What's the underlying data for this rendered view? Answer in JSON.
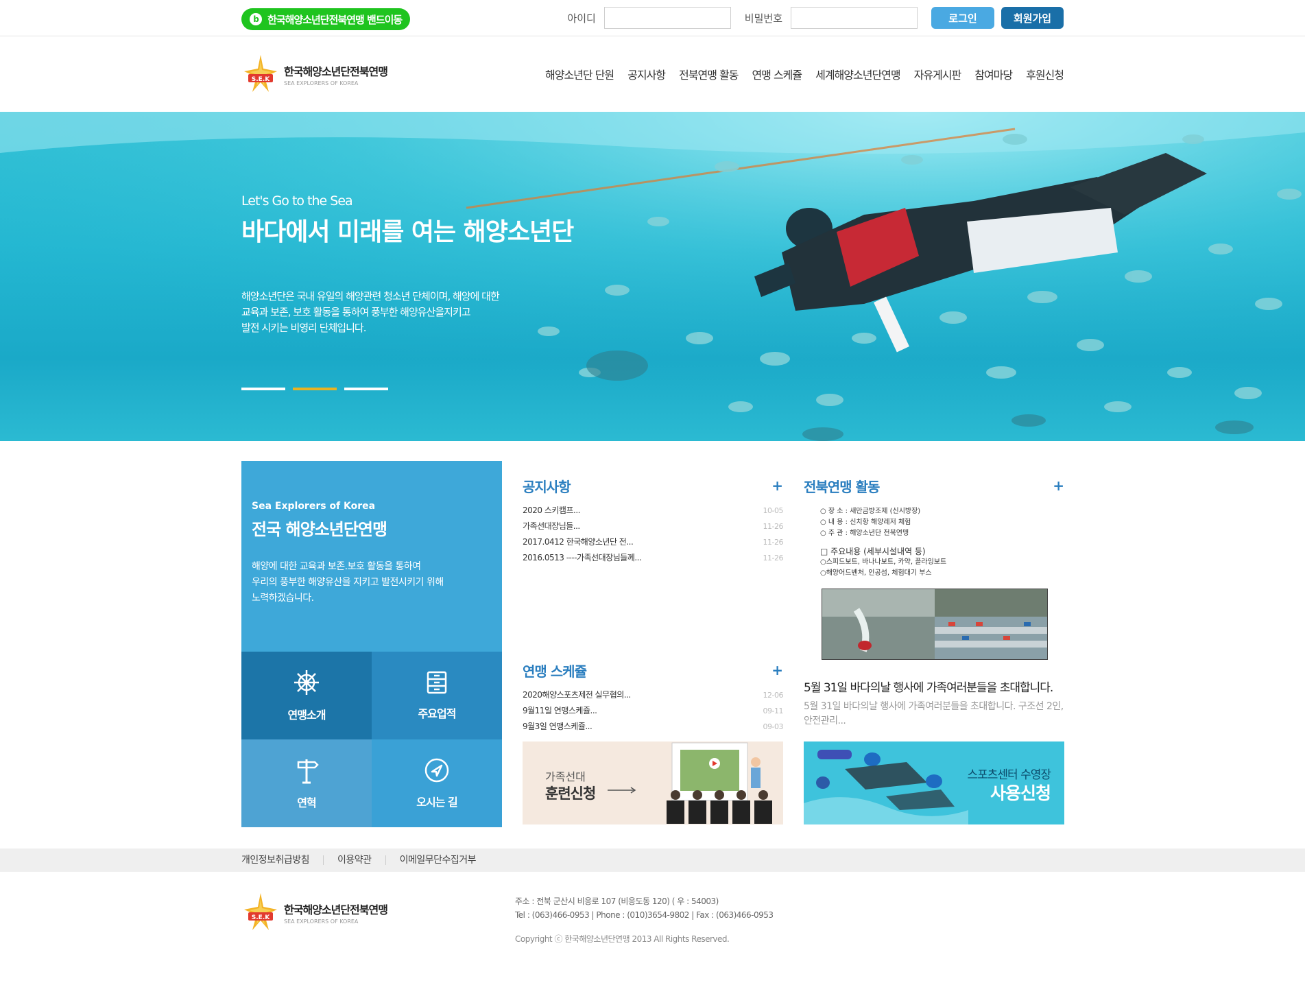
{
  "topbar": {
    "band_button": "한국해양소년단전북연맹 밴드이동",
    "id_label": "아이디",
    "password_label": "비밀번호",
    "login_button": "로그인",
    "join_button": "회원가입"
  },
  "header": {
    "logo_title": "한국해양소년단전북연맹",
    "logo_sub": "SEA EXPLORERS OF KOREA",
    "logo_badge": "S.E.K",
    "nav": [
      "해양소년단 단원",
      "공지사항",
      "전북연맹 활동",
      "연맹 스케쥴",
      "세계해양소년단연맹",
      "자유게시판",
      "참여마당",
      "후원신청"
    ]
  },
  "hero": {
    "subtitle": "Let's Go to the Sea",
    "title": "바다에서 미래를 여는 해양소년단",
    "desc_line1": "해양소년단은 국내 유일의 해양관련 청소년 단체이며, 해양에 대한",
    "desc_line2": "교육과 보존, 보호 활동을 통하여 풍부한 해양유산을지키고",
    "desc_line3": "발전 시키는 비영리 단체입니다.",
    "active_slide": 2,
    "colors": {
      "indicator_active": "#e8b323",
      "indicator": "#ffffff"
    }
  },
  "intro": {
    "en": "Sea Explorers of Korea",
    "title": "전국 해양소년단연맹",
    "desc_line1": "해양에 대한 교육과 보존.보호 활동을 통하여",
    "desc_line2": "우리의 풍부한 해양유산을 지키고 발전시키기 위해",
    "desc_line3": "노력하겠습니다."
  },
  "quick": {
    "items": [
      {
        "label": "연맹소개",
        "icon": "ship-wheel-icon"
      },
      {
        "label": "주요업적",
        "icon": "archive-icon"
      },
      {
        "label": "연혁",
        "icon": "signpost-icon"
      },
      {
        "label": "오시는 길",
        "icon": "compass-icon"
      }
    ]
  },
  "notice": {
    "title": "공지사항",
    "plus": "+",
    "items": [
      {
        "text": "2020 스키캠프...",
        "date": "10-05"
      },
      {
        "text": "가족선대장님들...",
        "date": "11-26"
      },
      {
        "text": "2017.0412 한국해양소년단 전...",
        "date": "11-26"
      },
      {
        "text": "2016.0513 ----가족선대장님들께...",
        "date": "11-26"
      }
    ]
  },
  "schedule": {
    "title": "연맹 스케쥴",
    "plus": "+",
    "items": [
      {
        "text": "2020해양스포츠제전 실무협의...",
        "date": "12-06"
      },
      {
        "text": "9월11일 연맹스케쥴...",
        "date": "09-11"
      },
      {
        "text": "9월3일 연맹스케쥴...",
        "date": "09-03"
      }
    ]
  },
  "activity": {
    "title": "전북연맹 활동",
    "plus": "+",
    "doc_line1": "○ 장  소 : 새만금방조제 (신시방장)",
    "doc_line2": "○ 내  용 : 신치항 해양레저 체험",
    "doc_line3": "○ 주  관 : 해양소년단 전북연맹",
    "doc_line4": "□ 주요내용 (세부시설내역 등)",
    "doc_line5": "○스피드보트, 바나나보트, 카약, 플라잉보트",
    "doc_line6": "○해양어드벤처, 인공섬, 체험대기 부스",
    "post_title": "5월 31일 바다의날 행사에 가족여러분들을 초대합니다.",
    "post_desc": "5월 31일 바다의날 행사에 가족여러분들을 초대합니다. 구조선 2인, 안전관리..."
  },
  "banners": {
    "training_line1": "가족선대",
    "training_line2": "훈련신청",
    "pool_line1": "스포츠센터 수영장",
    "pool_line2": "사용신청"
  },
  "footer": {
    "links": [
      "개인정보취급방침",
      "이용약관",
      "이메일무단수집거부"
    ],
    "address": "주소 : 전북 군산시 비응로 107 (비응도동 120) ( 우 : 54003)",
    "contact": "Tel : (063)466-0953 | Phone : (010)3654-9802 | Fax : (063)466-0953",
    "copyright": "Copyright ⓒ 한국해양소년단연맹 2013 All Rights Reserved."
  }
}
